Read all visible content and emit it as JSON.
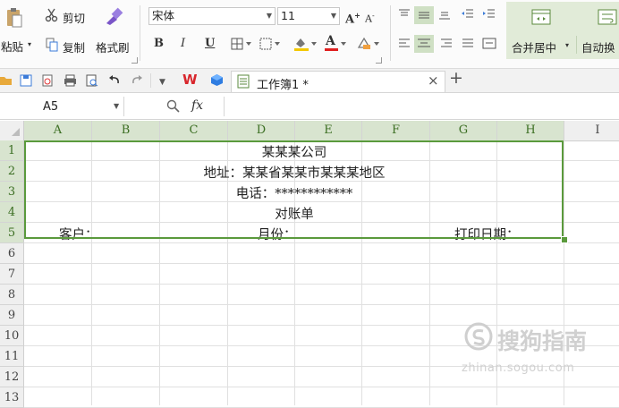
{
  "ribbon": {
    "paste_label": "粘贴",
    "cut_label": "剪切",
    "copy_label": "复制",
    "format_painter_label": "格式刷",
    "font_name": "宋体",
    "font_size": "11",
    "bold": "B",
    "italic": "I",
    "underline": "U",
    "font_color_glyph": "A",
    "merge_center_label": "合并居中",
    "auto_wrap_label": "自动换"
  },
  "tabbar": {
    "logo": "W",
    "tab_label": "工作簿1 *",
    "close": "×",
    "add": "+"
  },
  "formula_bar": {
    "cell_ref": "A5",
    "fx": "fx"
  },
  "columns": [
    "A",
    "B",
    "C",
    "D",
    "E",
    "F",
    "G",
    "H",
    "I"
  ],
  "rows": [
    "1",
    "2",
    "3",
    "4",
    "5",
    "6",
    "7",
    "8",
    "9",
    "10",
    "11",
    "12",
    "13"
  ],
  "cells": {
    "r1": "某某某公司",
    "r2": "地址：某某省某某市某某某地区",
    "r3": "电话：************",
    "r4": "对账单",
    "r5_customer": "客户：",
    "r5_month": "月份：",
    "r5_print_date": "打印日期："
  },
  "watermark": {
    "text": "搜狗指南",
    "url": "zhinan.sogou.com"
  }
}
